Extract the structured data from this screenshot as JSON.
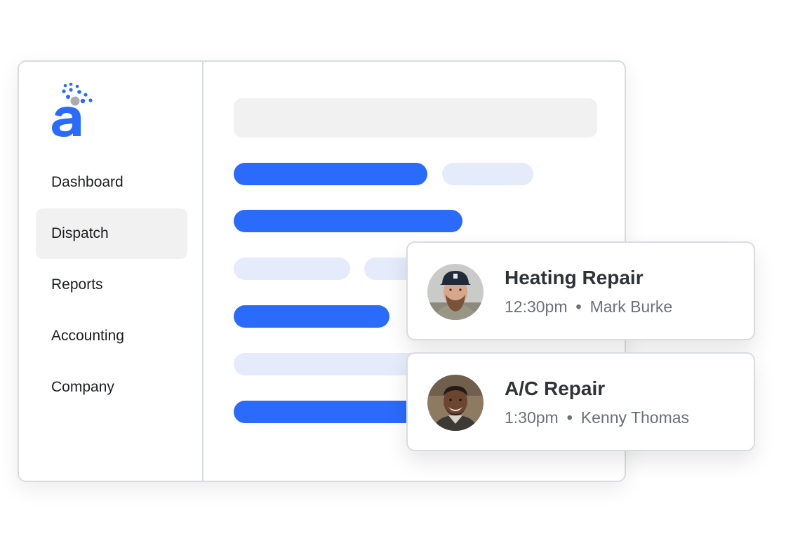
{
  "brand": {
    "logo_letter": "a",
    "primary_color": "#2a6bfb",
    "accent_grey": "#a9abae"
  },
  "sidebar": {
    "items": [
      {
        "label": "Dashboard",
        "active": false
      },
      {
        "label": "Dispatch",
        "active": true
      },
      {
        "label": "Reports",
        "active": false
      },
      {
        "label": "Accounting",
        "active": false
      },
      {
        "label": "Company",
        "active": false
      }
    ]
  },
  "jobs": [
    {
      "title": "Heating Repair",
      "time": "12:30pm",
      "separator": "•",
      "technician": "Mark Burke",
      "avatar_icon": "technician-photo"
    },
    {
      "title": "A/C Repair",
      "time": "1:30pm",
      "separator": "•",
      "technician": "Kenny Thomas",
      "avatar_icon": "technician-photo"
    }
  ],
  "colors": {
    "skeleton_blue": "#2a6bfb",
    "skeleton_light": "#e4ebfb",
    "skeleton_grey": "#f1f1f1",
    "border": "#d9dcdf"
  }
}
